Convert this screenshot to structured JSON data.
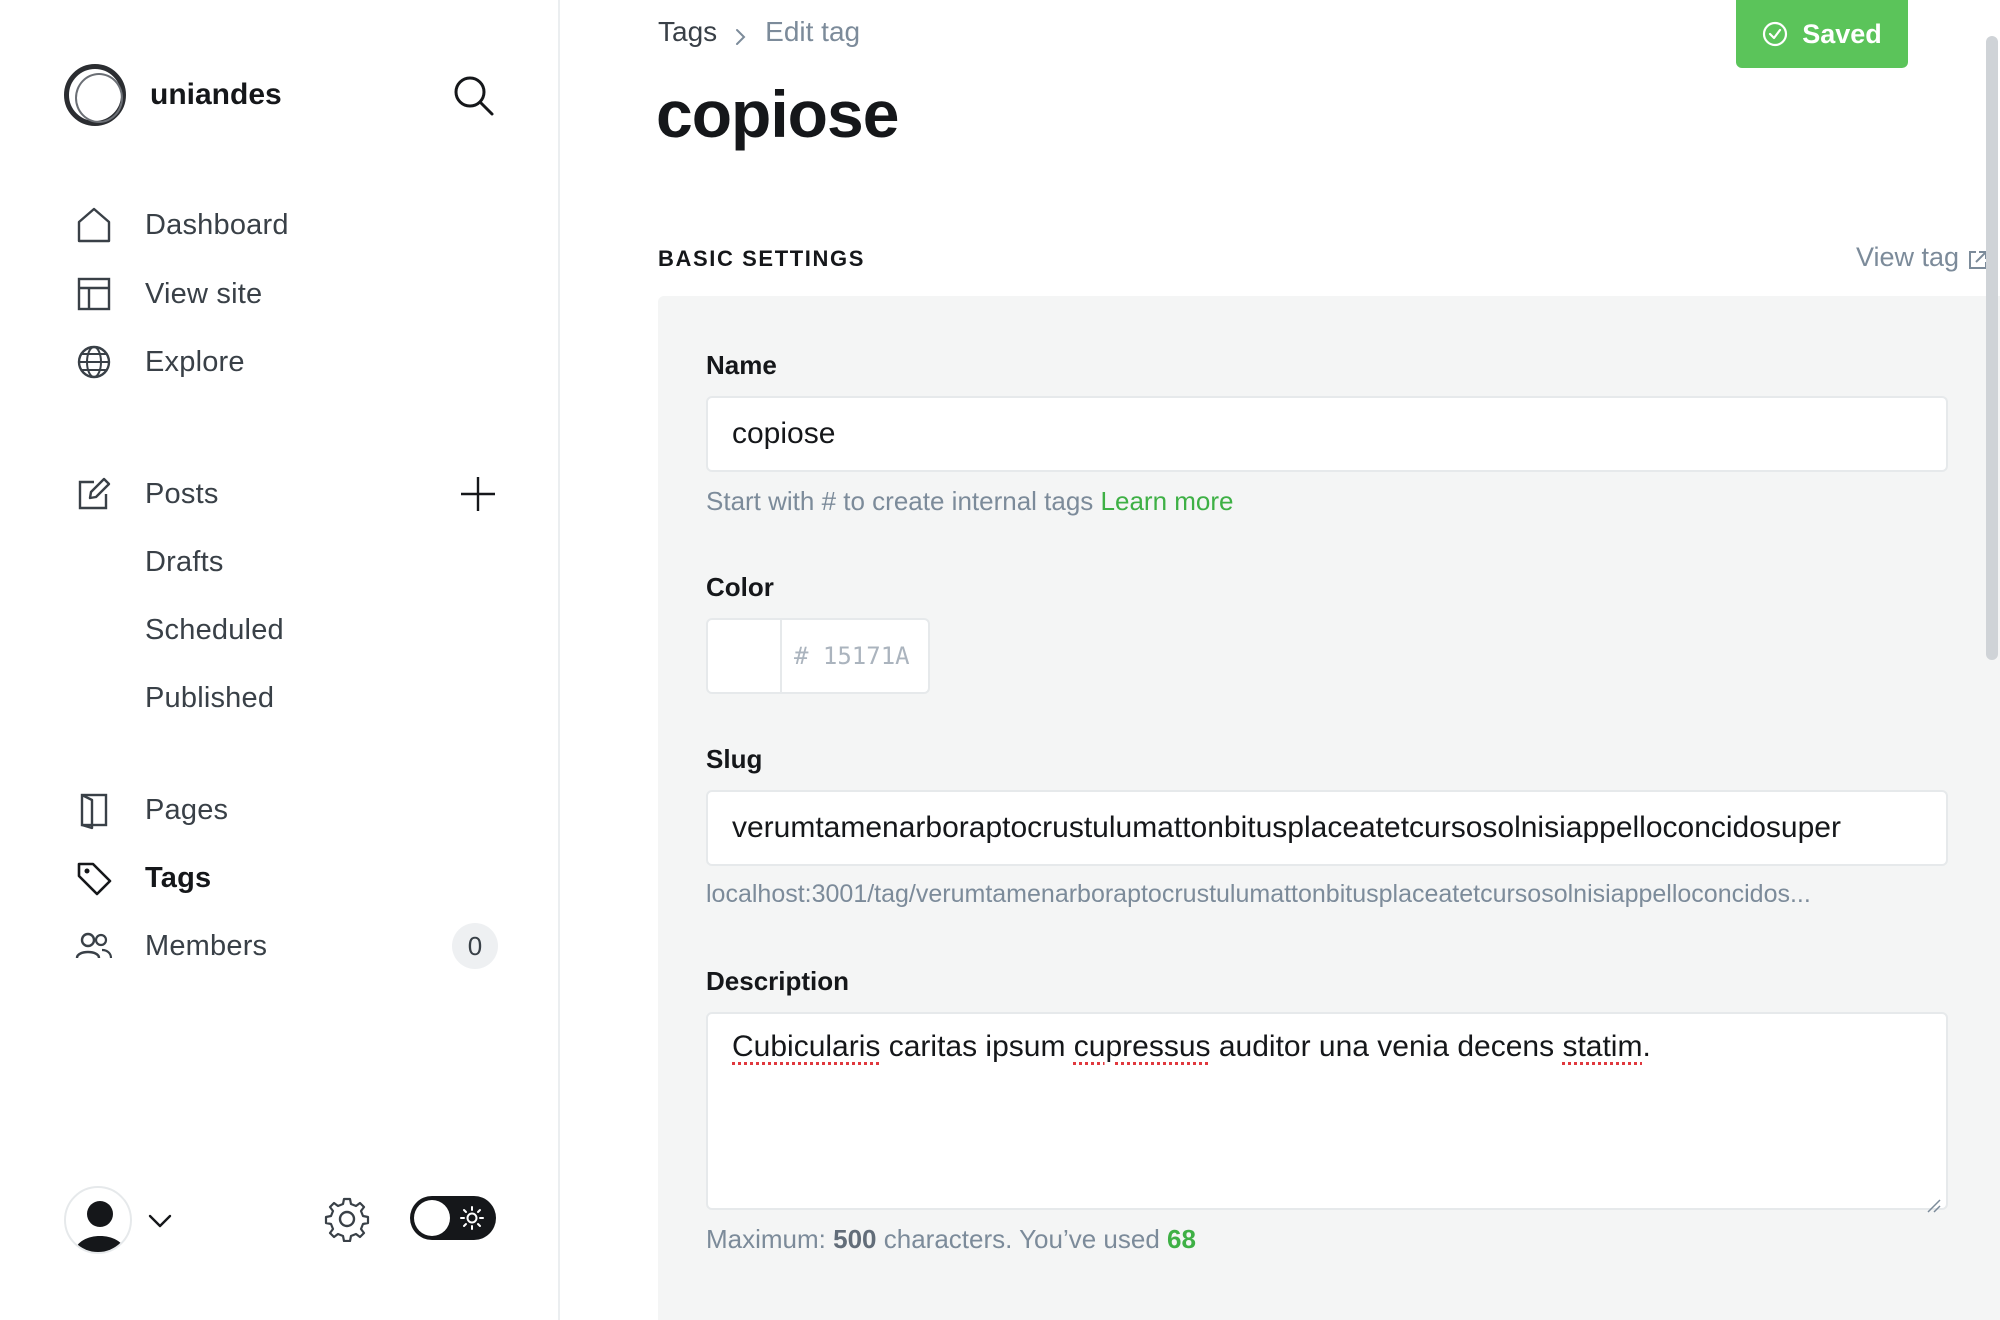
{
  "sidebar": {
    "brand": "uniandes",
    "nav": {
      "dashboard": "Dashboard",
      "view_site": "View site",
      "explore": "Explore",
      "posts": "Posts",
      "drafts": "Drafts",
      "scheduled": "Scheduled",
      "published": "Published",
      "pages": "Pages",
      "tags": "Tags",
      "members": "Members",
      "members_count": "0"
    },
    "icons": [
      "search-icon",
      "home-icon",
      "layout-icon",
      "globe-icon",
      "edit-icon",
      "plus-icon",
      "page-icon",
      "tag-icon",
      "members-icon",
      "user-avatar",
      "chevron-down-icon",
      "gear-icon",
      "sun-icon"
    ],
    "theme_toggle": "dark"
  },
  "header": {
    "breadcrumb_root": "Tags",
    "breadcrumb_current": "Edit tag",
    "title": "copiose",
    "saved_label": "Saved"
  },
  "section": {
    "label": "BASIC SETTINGS",
    "view_tag": "View tag"
  },
  "form": {
    "name_label": "Name",
    "name_value": "copiose",
    "name_hint": "Start with # to create internal tags",
    "name_hint_link": "Learn more",
    "color_label": "Color",
    "color_hex": "# 15171A",
    "slug_label": "Slug",
    "slug_value": "verumtamenarboraptocrustulumattonbitusplaceatetcursosolnisiappelloconcidosuper",
    "slug_url": "localhost:3001/tag/verumtamenarboraptocrustulumattonbitusplaceatetcursosolnisiappelloconcidos...",
    "description_label": "Description",
    "description_value": {
      "w1": "Cubicularis",
      "w2": " caritas ipsum ",
      "w3": "cupressus",
      "w4": " auditor una venia decens ",
      "w5": "statim",
      "w6": "."
    },
    "desc_hint_prefix": "Maximum: ",
    "desc_hint_max": "500",
    "desc_hint_mid": " characters. You’ve used ",
    "desc_hint_used": "68"
  },
  "colors": {
    "accent_green": "#5bc45a",
    "text_dark": "#15171a",
    "muted": "#7c8b9a",
    "panel_bg": "#f4f5f5"
  }
}
